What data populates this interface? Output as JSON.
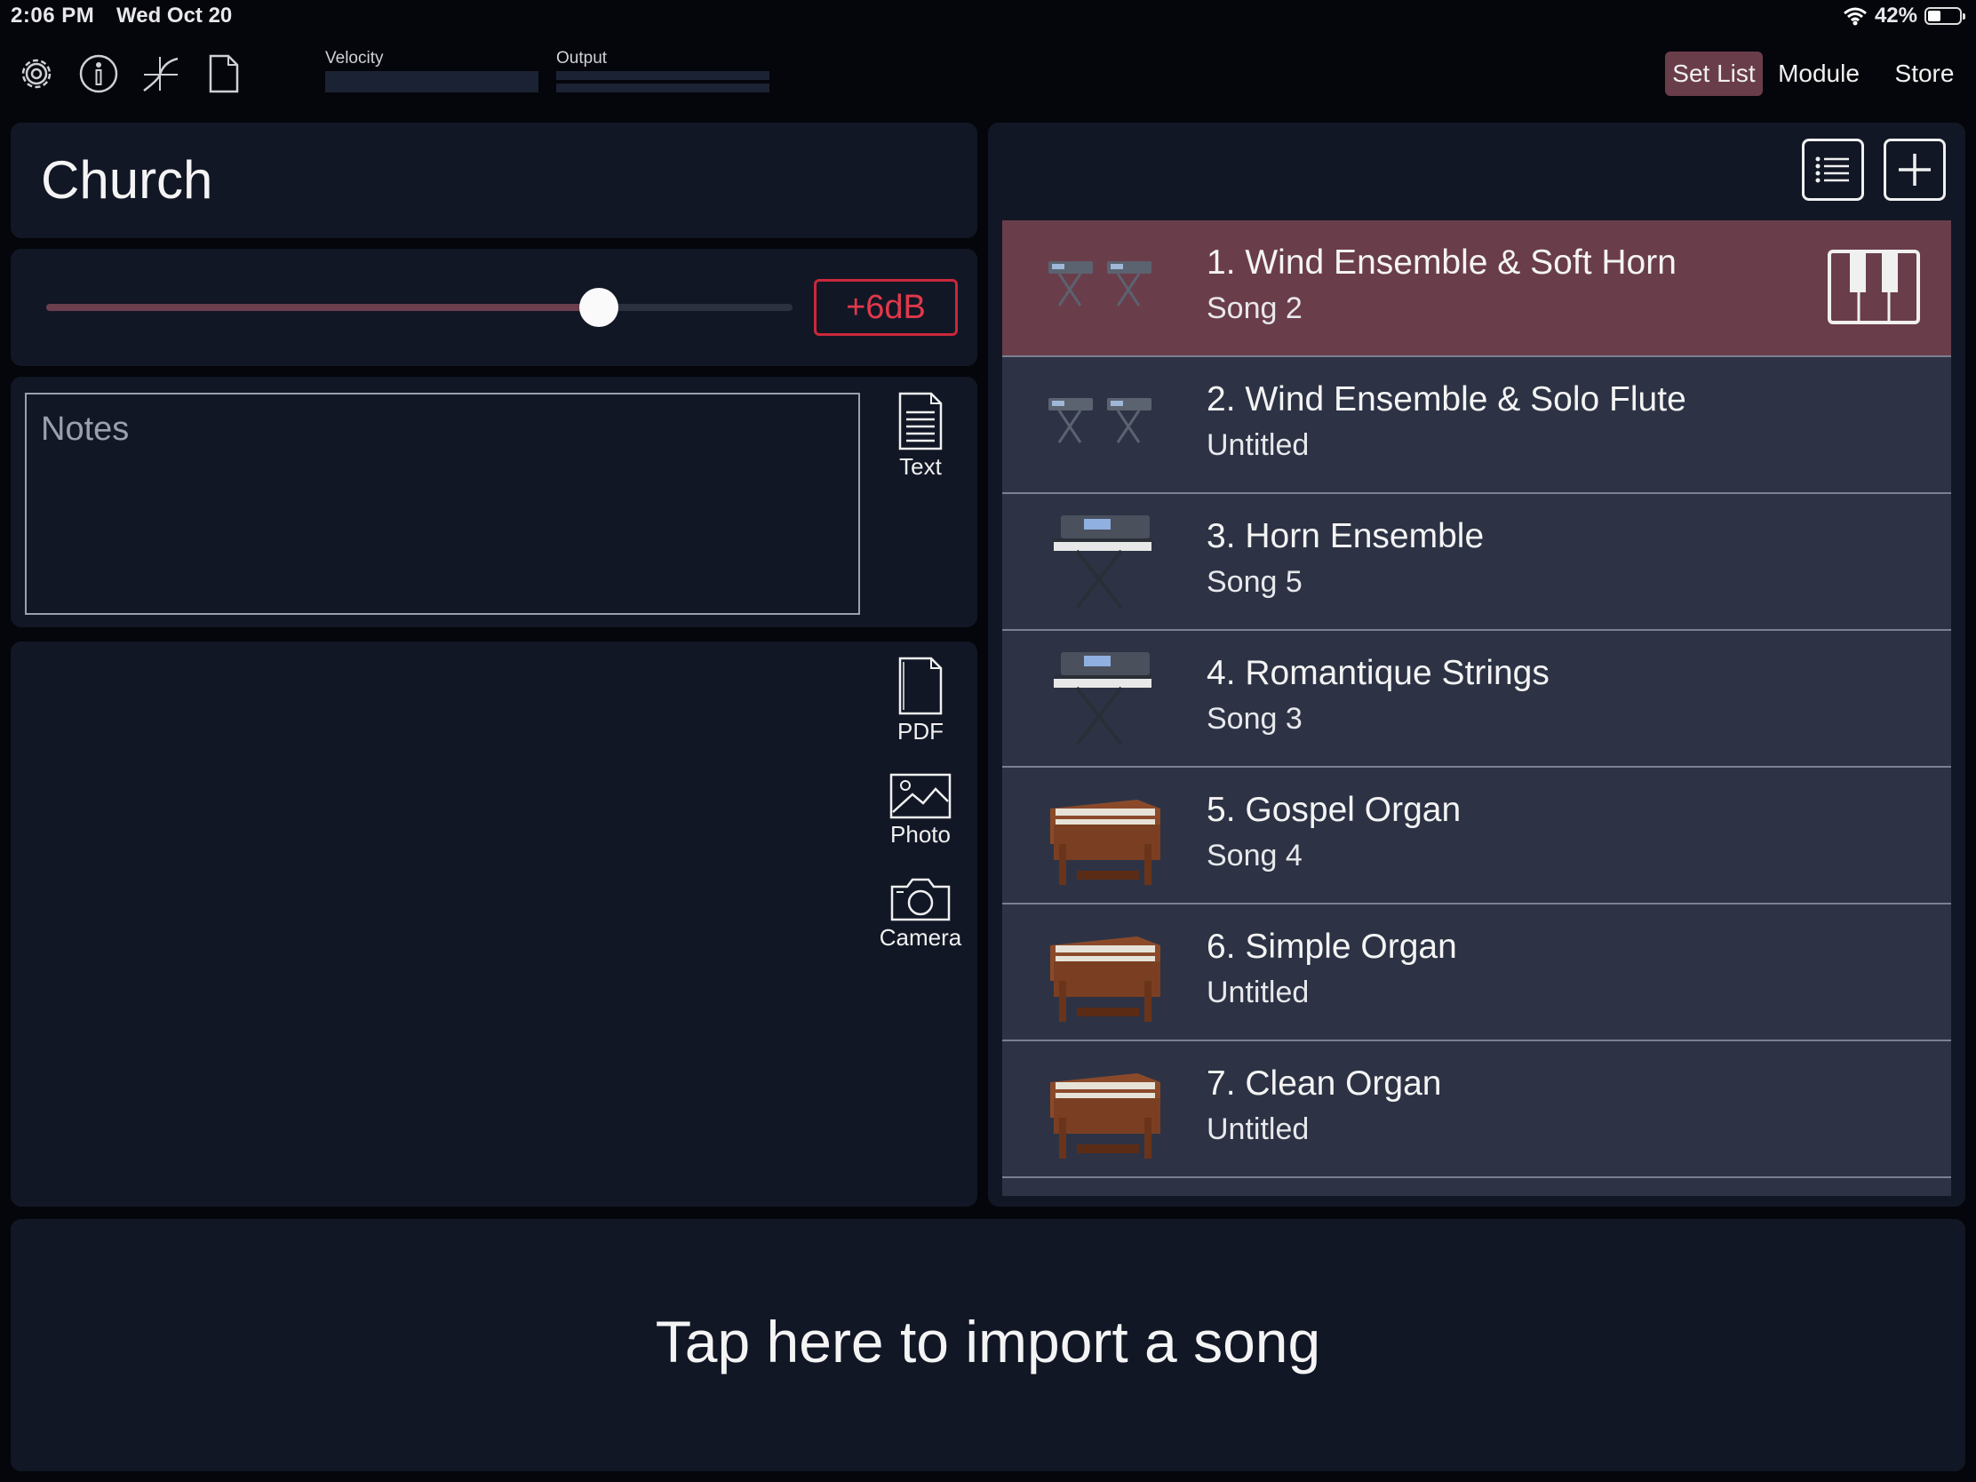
{
  "status_bar": {
    "time": "2:06 PM",
    "date": "Wed Oct 20",
    "battery": "42%"
  },
  "toolbar": {
    "icons": [
      "settings-icon",
      "info-icon",
      "curve-icon",
      "document-icon"
    ],
    "velocity_label": "Velocity",
    "output_label": "Output",
    "tabs": [
      {
        "label": "Set List",
        "active": true
      },
      {
        "label": "Module",
        "active": false
      },
      {
        "label": "Store",
        "active": false
      }
    ]
  },
  "setlist": {
    "title": "Church",
    "volume_level": 0.74,
    "gain_label": "+6dB",
    "notes_placeholder": "Notes"
  },
  "attachments": {
    "text_label": "Text",
    "pdf_label": "PDF",
    "photo_label": "Photo",
    "camera_label": "Camera"
  },
  "songs": [
    {
      "title": "1. Wind Ensemble & Soft Horn",
      "subtitle": "Song 2",
      "thumb": "two-keyboards",
      "selected": true
    },
    {
      "title": "2. Wind Ensemble & Solo Flute",
      "subtitle": "Untitled",
      "thumb": "two-keyboards",
      "selected": false
    },
    {
      "title": "3. Horn Ensemble",
      "subtitle": "Song 5",
      "thumb": "keyboard-stand",
      "selected": false
    },
    {
      "title": "4. Romantique Strings",
      "subtitle": "Song 3",
      "thumb": "keyboard-stand",
      "selected": false
    },
    {
      "title": "5. Gospel Organ",
      "subtitle": "Song 4",
      "thumb": "organ",
      "selected": false
    },
    {
      "title": "6. Simple Organ",
      "subtitle": "Untitled",
      "thumb": "organ",
      "selected": false
    },
    {
      "title": "7. Clean Organ",
      "subtitle": "Untitled",
      "thumb": "organ",
      "selected": false
    }
  ],
  "import": {
    "label": "Tap here to import a song"
  },
  "colors": {
    "accent": "#6a3d4a",
    "gain_red": "#e2384a",
    "panel": "#121726",
    "row": "#2d3345"
  }
}
